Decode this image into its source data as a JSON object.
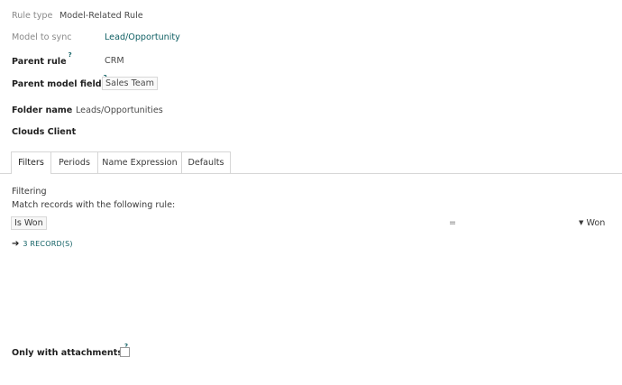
{
  "form": {
    "rule_type": {
      "label": "Rule type",
      "value": "Model-Related Rule"
    },
    "model_to_sync": {
      "label": "Model to sync",
      "value": "Lead/Opportunity"
    },
    "parent_rule": {
      "label": "Parent rule",
      "help": "?",
      "value": "CRM"
    },
    "parent_model_field": {
      "label": "Parent model field",
      "help": "?",
      "value": "Sales Team"
    },
    "folder_name": {
      "label": "Folder name",
      "value": "Leads/Opportunities"
    },
    "clouds_client": {
      "label": "Clouds Client"
    }
  },
  "tabs": [
    {
      "label": "Filters",
      "active": true
    },
    {
      "label": "Periods",
      "active": false
    },
    {
      "label": "Name Expression",
      "active": false
    },
    {
      "label": "Defaults",
      "active": false
    }
  ],
  "filters": {
    "section_title": "Filtering",
    "match_text": "Match records with the following rule:",
    "condition": {
      "field": "Is Won",
      "operator": "=",
      "value": "Won",
      "dropdown_icon": "caret-down-icon"
    },
    "records_link": "3 RECORD(S)",
    "records_icon": "arrow-right-icon"
  },
  "attachments": {
    "label": "Only with attachments",
    "help": "?",
    "checked": false
  }
}
